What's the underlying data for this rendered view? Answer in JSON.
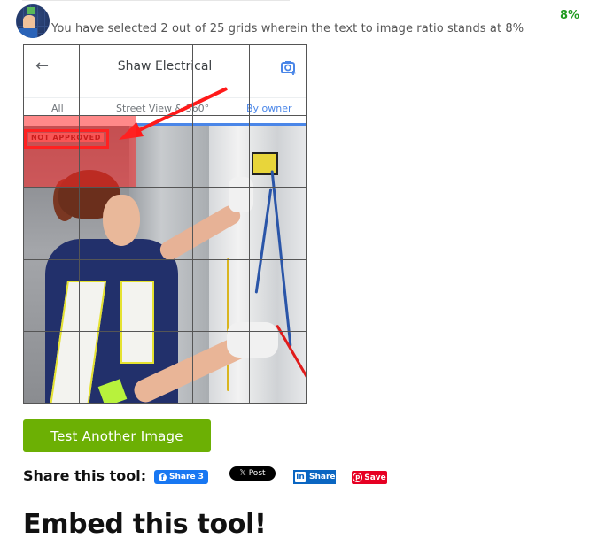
{
  "header": {
    "status_text": "You have selected 2 out of 25 grids wherein the text to image ratio stands at 8%",
    "percentage": "8%",
    "selected_count": 2,
    "total_grids": 25,
    "ratio_percent": 8
  },
  "image": {
    "app_title": "Shaw Electrical",
    "back_icon": "arrow-left-icon",
    "camera_icon": "add-photo-camera-icon",
    "tabs": [
      {
        "label": "All",
        "active": false
      },
      {
        "label": "Street View & 360°",
        "active": false
      },
      {
        "label": "By owner",
        "active": true
      }
    ],
    "annotation_label": "NOT APPROVED"
  },
  "grid": {
    "rows": 5,
    "cols": 5,
    "selected_cells": [
      [
        1,
        0
      ],
      [
        1,
        1
      ]
    ],
    "selected_color": "#ff2828"
  },
  "actions": {
    "test_another_label": "Test Another Image",
    "test_button_color": "#6cb004"
  },
  "share": {
    "label": "Share this tool:",
    "facebook": {
      "label": "Share 3",
      "icon": "facebook-icon",
      "color": "#1877f2"
    },
    "x": {
      "label": "Post",
      "icon": "x-logo-icon",
      "color": "#000000"
    },
    "linkedin": {
      "label": "Share",
      "icon": "linkedin-icon",
      "color": "#0a66c2"
    },
    "pinterest": {
      "label": "Save",
      "icon": "pinterest-icon",
      "color": "#e60023"
    }
  },
  "embed": {
    "heading": "Embed this tool!"
  },
  "colors": {
    "percentage_green": "#1f9a1f",
    "tab_active_blue": "#4a86e8"
  }
}
